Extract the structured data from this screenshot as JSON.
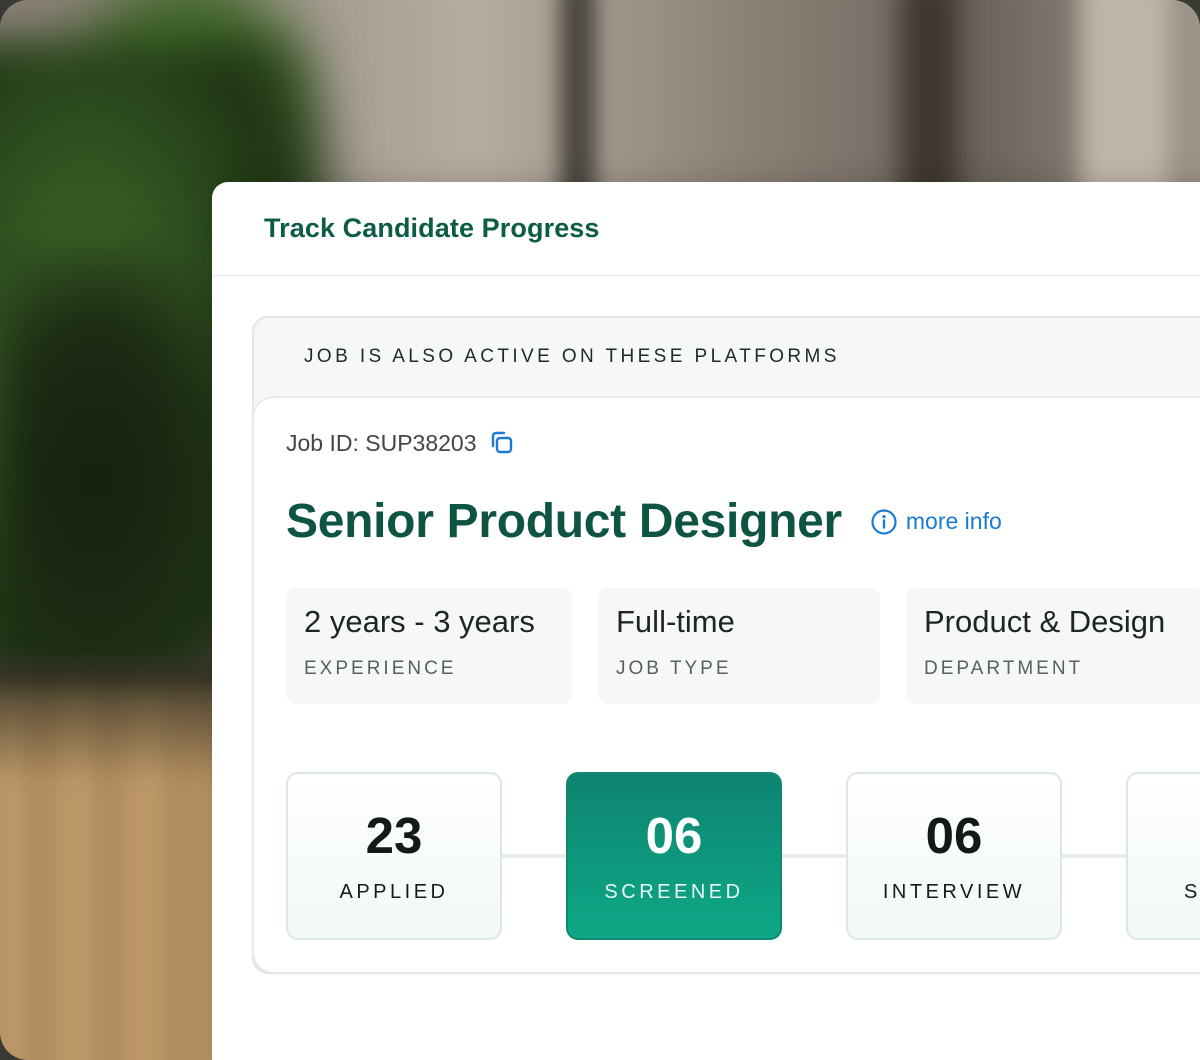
{
  "panel": {
    "title": "Track Candidate Progress"
  },
  "platforms": {
    "label": "JOB IS ALSO ACTIVE ON THESE PLATFORMS"
  },
  "job": {
    "id_text": "Job ID: SUP38203",
    "title": "Senior Product Designer",
    "more_info_label": "more info",
    "meta": [
      {
        "value": "2 years - 3 years",
        "label": "EXPERIENCE"
      },
      {
        "value": "Full-time",
        "label": "JOB TYPE"
      },
      {
        "value": "Product & Design",
        "label": "DEPARTMENT"
      }
    ]
  },
  "pipeline": {
    "stages": [
      {
        "count": "23",
        "label": "APPLIED",
        "active": false
      },
      {
        "count": "06",
        "label": "SCREENED",
        "active": true
      },
      {
        "count": "06",
        "label": "INTERVIEW",
        "active": false
      },
      {
        "count": "",
        "label": "S",
        "active": false
      }
    ]
  },
  "colors": {
    "brand_green": "#0d5443",
    "accent_teal": "#0ea887",
    "link_blue": "#1a7ad4"
  },
  "icons": {
    "copy": "copy-icon",
    "info": "info-icon"
  }
}
